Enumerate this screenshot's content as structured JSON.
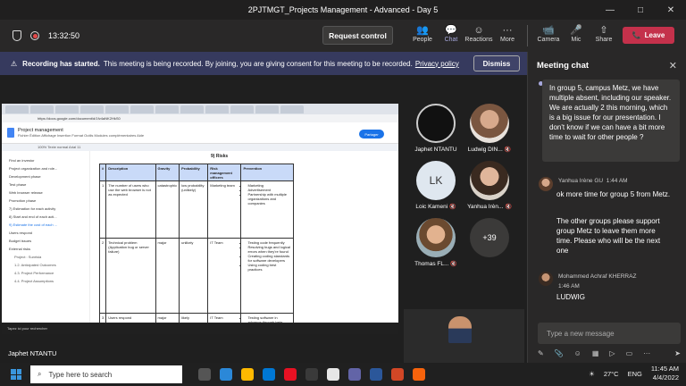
{
  "window": {
    "title": "2PJTMGT_Projects Management - Advanced - Day 5",
    "controls": [
      "—",
      "□",
      "✕"
    ]
  },
  "toolbar": {
    "timer": "13:32:50",
    "request_control": "Request control",
    "buttons": [
      {
        "label": "People",
        "icon": "👥"
      },
      {
        "label": "Chat",
        "icon": "💬"
      },
      {
        "label": "Reactions",
        "icon": "☺"
      },
      {
        "label": "More",
        "icon": "···"
      },
      {
        "label": "Camera",
        "icon": "📹"
      },
      {
        "label": "Mic",
        "icon": "🎤"
      },
      {
        "label": "Share",
        "icon": "⇧"
      }
    ],
    "leave": "Leave",
    "leave_icon": "📞"
  },
  "banner": {
    "bold": "Recording has started.",
    "text": "This meeting is being recorded. By joining, you are giving consent for this meeting to be recorded.",
    "link": "Privacy policy",
    "dismiss": "Dismiss"
  },
  "shared_screen": {
    "url": "https://docs.google.com/document/d/1fv4aNK2HkS0",
    "doc_title": "Project management",
    "menu": "Fichier Édition Affichage Insertion Format Outils Modules complémentaires Aide",
    "share": "Partager",
    "format_bar": "100%  Texte normal  Arial  11",
    "outline": [
      {
        "t": "Find an investor",
        "c": ""
      },
      {
        "t": "Project organization and role...",
        "c": ""
      },
      {
        "t": "Development phase",
        "c": ""
      },
      {
        "t": "Test phase",
        "c": ""
      },
      {
        "t": "Web browser release",
        "c": ""
      },
      {
        "t": "Promotion phase",
        "c": ""
      },
      {
        "t": "7) Estimation for each activity",
        "c": ""
      },
      {
        "t": "8) Start and end of each acti...",
        "c": ""
      },
      {
        "t": "9) Estimate the cost of each ...",
        "c": "hl"
      },
      {
        "t": "Users respond",
        "c": ""
      },
      {
        "t": "Budget issues",
        "c": ""
      },
      {
        "t": "External risks",
        "c": ""
      },
      {
        "t": "Project : Sunrisia",
        "c": "sub"
      },
      {
        "t": "1.2. Anticipated Outcomes",
        "c": "sub"
      },
      {
        "t": "4.3. Project Performance",
        "c": "sub"
      },
      {
        "t": "4.4. Project Assumptions",
        "c": "sub"
      }
    ],
    "risk_title": "9) Risks",
    "table": {
      "headers": [
        "#",
        "Description",
        "Gravity",
        "Probability",
        "Risk management officers",
        "Prevention"
      ],
      "rows": [
        {
          "n": "1",
          "desc": "The number of users who use the web browser is not as expected",
          "grav": "catastrophic",
          "prob": "low probability (unlikely)",
          "off": "Marketing team",
          "prev": [
            "Marketing",
            "Advertisement",
            "Partnership with multiple organizations and companies"
          ]
        },
        {
          "n": "2",
          "desc": "Technical problem (Application bug or server failure)",
          "grav": "major",
          "prob": "unlikely",
          "off": "IT Team",
          "prev": [
            "Testing code frequently",
            "Resolving bugs and logical errors when they’re found",
            "Creating coding standards for software developers",
            "Using coding best practices"
          ]
        },
        {
          "n": "3",
          "desc": "Users respond",
          "grav": "major",
          "prob": "likely",
          "off": "IT Team",
          "prev": [
            "Testing software in advance through beta testing and user"
          ]
        }
      ]
    },
    "taskbar_text": "Tapez ici pour rechercher"
  },
  "presenter_label": "Japhet NTANTU",
  "participants": [
    {
      "name": "Japhet NTANTU",
      "initials": "",
      "style": "av-dark",
      "muted": false
    },
    {
      "name": "Ludwig DIN...",
      "initials": "",
      "style": "av-photo1",
      "muted": true
    },
    {
      "name": "Loic Kameni",
      "initials": "LK",
      "style": "av-lk",
      "muted": true
    },
    {
      "name": "Yanhua Irèn...",
      "initials": "",
      "style": "av-photo2",
      "muted": true
    },
    {
      "name": "Thomas FL...",
      "initials": "",
      "style": "av-photo3",
      "muted": true
    },
    {
      "name": "",
      "initials": "+39",
      "style": "av-more",
      "muted": false
    }
  ],
  "chat": {
    "title": "Meeting chat",
    "close": "✕",
    "messages": [
      {
        "text": "In group 5, campus Metz, we have multiple absent, including our speaker. We are actually 2 this morning, which is a big issue for our presentation. I don't know if we can have a bit more time to wait for other people ?"
      },
      {
        "author": "Yanhua Irène GU",
        "time": "1:44 AM",
        "text": "ok more time for group 5 from Metz."
      },
      {
        "text": "The other groups please support group Metz to leave them more time. Please who will be the next one"
      },
      {
        "author": "Mohammed Achraf KHERRAZ",
        "time": "1:46 AM",
        "text": "LUDWIG"
      }
    ],
    "input_placeholder": "Type a new message",
    "tools": [
      "✎",
      "📎",
      "☺",
      "▦",
      "▷",
      "▭",
      "···",
      "➤"
    ]
  },
  "taskbar": {
    "search": "Type here to search",
    "weather": "27°C",
    "lang": "ENG",
    "time": "11:45 AM",
    "date": "4/4/2022",
    "app_colors": [
      "#555",
      "#2b88d8",
      "#ffb900",
      "#0078d4",
      "#e81123",
      "#3a3a3a",
      "#e6e6e6",
      "#6264a7",
      "#2b579a",
      "#d24726",
      "#f7630c"
    ]
  }
}
